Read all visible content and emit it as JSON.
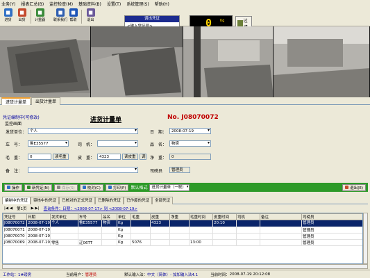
{
  "menu": [
    "业务(Y)",
    "报表汇总(B)",
    "监控检查(M)",
    "基础资料(B)",
    "设置(T)",
    "系统管理(S)",
    "帮助(H)"
  ],
  "toolbar": [
    {
      "label": "进货",
      "icon": "truck-in-icon",
      "color": "#2e6fc4"
    },
    {
      "label": "出货",
      "icon": "truck-out-icon",
      "color": "#c44a2e"
    },
    {
      "label": "计重器",
      "icon": "scale-icon",
      "color": "#3a8a3a"
    },
    {
      "label": "联系我们",
      "icon": "contact-icon",
      "color": "#2f5fb0"
    },
    {
      "label": "帮助",
      "icon": "help-icon",
      "color": "#1d55b7"
    },
    {
      "label": "退出",
      "icon": "exit-icon",
      "color": "#6b5a9a"
    }
  ],
  "call_voucher": {
    "title": "调出凭证",
    "placeholder": "<输入凭证号>"
  },
  "weight": {
    "value": "0",
    "unit": "Kg",
    "status": "称重稳定  请准备过磅"
  },
  "filter_label": "过滤",
  "tabs_main": [
    "进货计量单",
    "出货计量单"
  ],
  "form": {
    "status": "凭证编制中(可修改)",
    "monitor": "监控画面",
    "title": "进货计量单",
    "doc_no": "No. J08070072",
    "labels": {
      "supplier": "发货单位：",
      "date": "日　期：",
      "plate": "车　号：",
      "driver": "司　机：",
      "product": "品　名：",
      "gross": "毛　重：",
      "tare": "皮　重：",
      "net": "净　重：",
      "note": "备　注：",
      "operator": "司磅员"
    },
    "values": {
      "supplier": "个人",
      "date": "2008-07-19",
      "plate": "鲁E35577",
      "driver": "",
      "product": "物资",
      "gross": "0",
      "tare": "4323",
      "net": "0",
      "note": "",
      "operator": "管理员"
    },
    "read_gross": "读毛重",
    "read_tare": "读皮重",
    "tare_btn2": "调"
  },
  "actions": [
    "操作",
    "新凭证(N)",
    "保存(S)",
    "校对(C)",
    "打印(P)",
    "默认格式",
    "进货计量单（一联）",
    "退出(E)"
  ],
  "tabs_sub": [
    "编制中的凭证",
    "审核中的凭证",
    "已核对的正式凭证",
    "已删除的凭证",
    "已作废的凭证",
    "全部凭证"
  ],
  "pager": {
    "page": "第1页",
    "filter": "查询条件：日期：<2008-07-17> 到 <2008-07-19>"
  },
  "grid": {
    "columns": [
      "凭证号",
      "日期",
      "发货单位",
      "车号",
      "品名",
      "单位",
      "毛重",
      "皮重",
      "净重",
      "毛重时间",
      "皮重时间",
      "司机",
      "备注",
      "司磅员"
    ],
    "rows": [
      [
        "J08070072",
        "2008-07-19",
        "个人",
        "鲁E35577",
        "物资",
        "Kg",
        "",
        "4323",
        "",
        "",
        "20:10",
        "",
        "",
        "管理员"
      ],
      [
        "J08070071",
        "2008-07-19",
        "",
        "",
        "",
        "Kg",
        "",
        "",
        "",
        "",
        "",
        "",
        "",
        "管理员"
      ],
      [
        "J08070070",
        "2008-07-19",
        "",
        "",
        "",
        "Kg",
        "",
        "",
        "",
        "",
        "",
        "",
        "",
        "管理员"
      ],
      [
        "J08070069",
        "2008-07-19",
        "零售",
        "辽06TT",
        "",
        "Kg",
        "5076",
        "",
        "",
        "13:00",
        "",
        "",
        "",
        "管理员"
      ]
    ]
  },
  "status": {
    "station": "工作站：1#磅房",
    "user_label": "当前用户：",
    "user": "管理员",
    "ime_label": "默认输入法：",
    "ime": "中文（简体）- 加加输入法4.1",
    "time_label": "当前时间：",
    "time": "2008-07-19 20:12:08"
  }
}
